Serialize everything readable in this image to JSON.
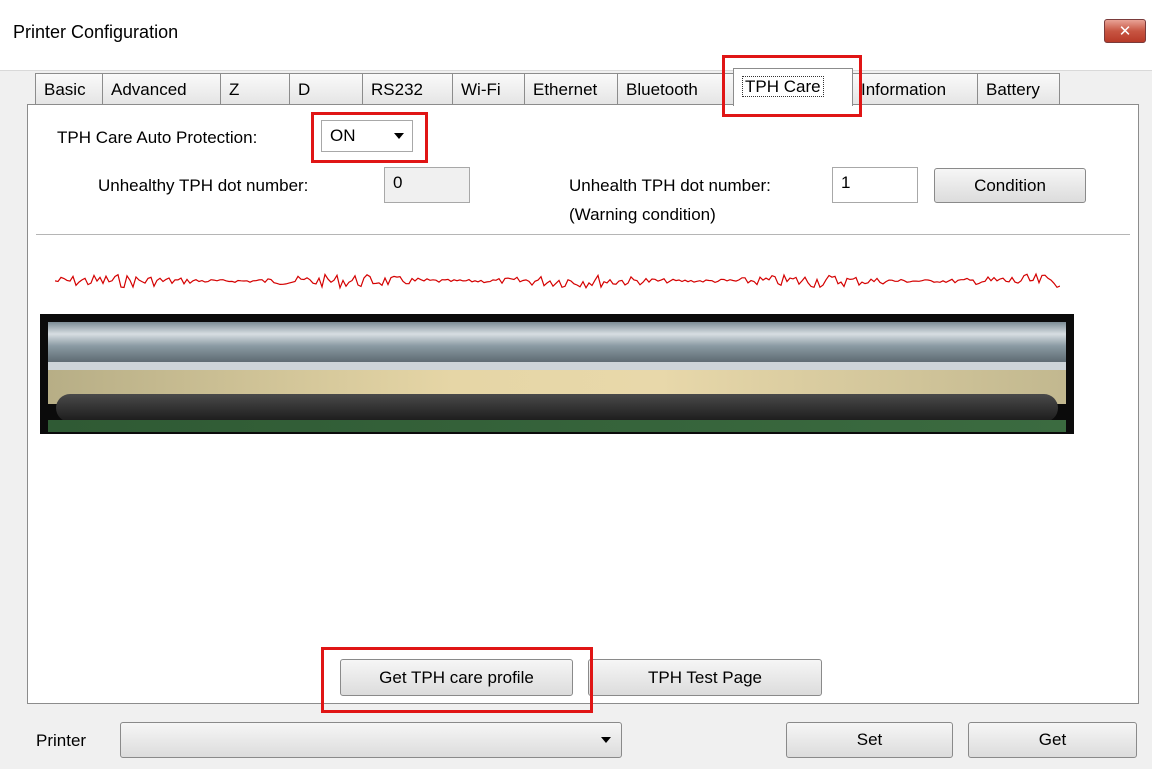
{
  "window": {
    "title": "Printer Configuration",
    "close_glyph": "✕"
  },
  "tabs": [
    "Basic",
    "Advanced",
    "Z",
    "D",
    "RS232",
    "Wi-Fi",
    "Ethernet",
    "Bluetooth",
    "TPH Care",
    "Information",
    "Battery"
  ],
  "active_tab": "TPH Care",
  "tph": {
    "auto_protection_label": "TPH Care Auto Protection:",
    "auto_protection_value": "ON",
    "unhealthy_label": "Unhealthy TPH dot number:",
    "unhealthy_value": "0",
    "warning_label": "Unhealth TPH dot number:",
    "warning_value": "1",
    "warning_note": "(Warning condition)",
    "condition_button": "Condition",
    "get_profile_button": "Get TPH care profile",
    "test_page_button": "TPH Test Page"
  },
  "footer": {
    "printer_label": "Printer",
    "printer_value": "",
    "set_button": "Set",
    "get_button": "Get"
  },
  "colors": {
    "highlight": "#e01515",
    "waveform": "#d40000"
  }
}
